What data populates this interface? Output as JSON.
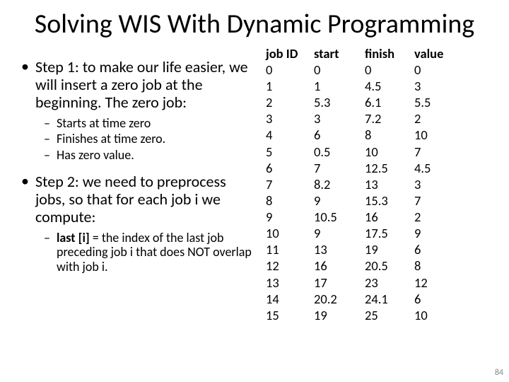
{
  "title": "Solving WIS With Dynamic Programming",
  "bullets": {
    "step1": "Step 1: to make our life easier, we will insert a zero job at the beginning. The zero job:",
    "step1_sub": [
      "Starts at time zero",
      "Finishes at time zero.",
      "Has zero value."
    ],
    "step2": "Step 2: we need to preprocess jobs, so that for each job i we compute:",
    "step2_sub_prefix": "last [i]",
    "step2_sub_rest": " = the index of the last job preceding job i that does NOT overlap with job i."
  },
  "table": {
    "headers": {
      "c1": "job ID",
      "c2": "start",
      "c3": "finish",
      "c4": "value"
    },
    "rows": [
      {
        "c1": "0",
        "c2": "0",
        "c3": "0",
        "c4": "0"
      },
      {
        "c1": "1",
        "c2": "1",
        "c3": "4.5",
        "c4": "3"
      },
      {
        "c1": "2",
        "c2": "5.3",
        "c3": "6.1",
        "c4": "5.5"
      },
      {
        "c1": "3",
        "c2": "3",
        "c3": "7.2",
        "c4": "2"
      },
      {
        "c1": "4",
        "c2": "6",
        "c3": "8",
        "c4": "10"
      },
      {
        "c1": "5",
        "c2": "0.5",
        "c3": "10",
        "c4": "7"
      },
      {
        "c1": "6",
        "c2": "7",
        "c3": "12.5",
        "c4": "4.5"
      },
      {
        "c1": "7",
        "c2": "8.2",
        "c3": "13",
        "c4": "3"
      },
      {
        "c1": "8",
        "c2": "9",
        "c3": "15.3",
        "c4": "7"
      },
      {
        "c1": "9",
        "c2": "10.5",
        "c3": "16",
        "c4": "2"
      },
      {
        "c1": "10",
        "c2": "9",
        "c3": "17.5",
        "c4": "9"
      },
      {
        "c1": "11",
        "c2": "13",
        "c3": "19",
        "c4": "6"
      },
      {
        "c1": "12",
        "c2": "16",
        "c3": "20.5",
        "c4": "8"
      },
      {
        "c1": "13",
        "c2": "17",
        "c3": "23",
        "c4": "12"
      },
      {
        "c1": "14",
        "c2": "20.2",
        "c3": "24.1",
        "c4": "6"
      },
      {
        "c1": "15",
        "c2": "19",
        "c3": "25",
        "c4": "10"
      }
    ]
  },
  "page_number": "84"
}
